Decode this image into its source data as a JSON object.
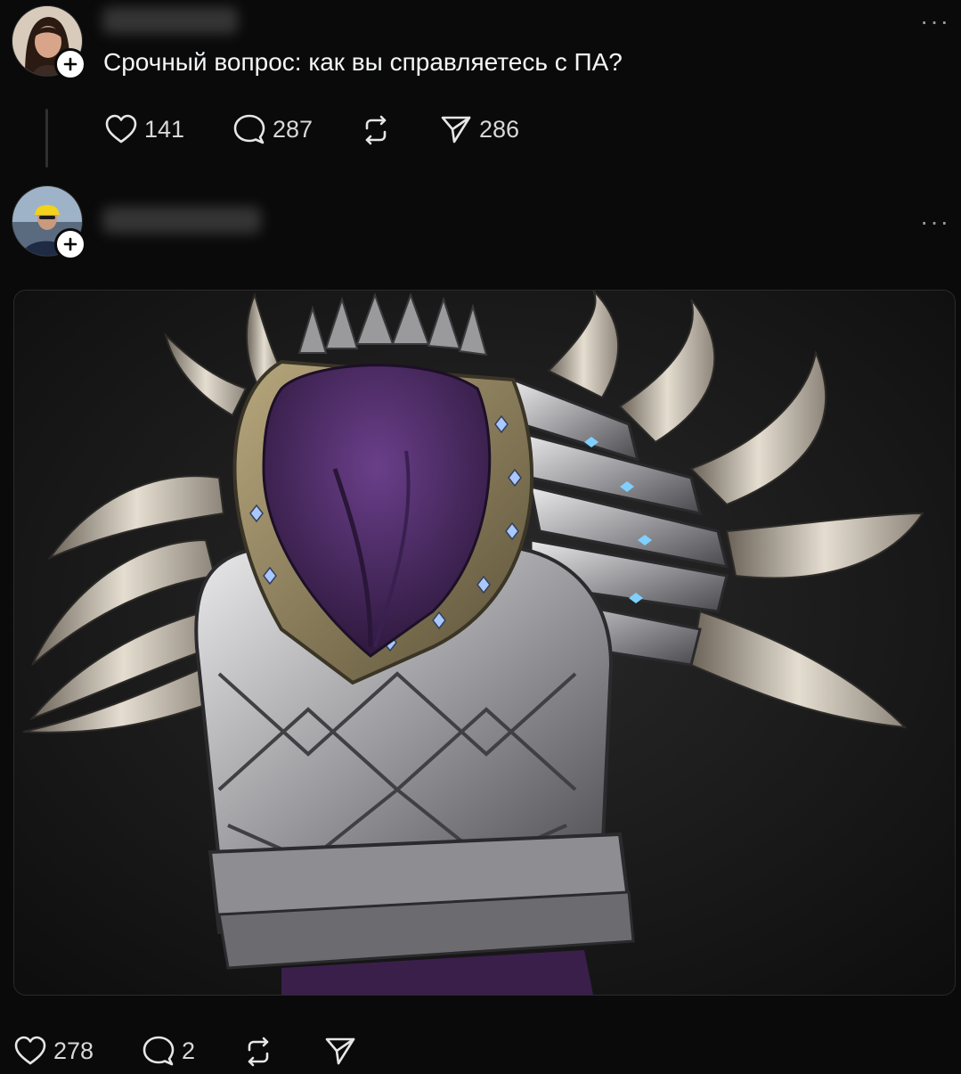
{
  "post1": {
    "avatar_icon": "user-avatar-woman",
    "text": "Срочный вопрос: как вы справляетесь с ПА?",
    "more": "···",
    "stats": {
      "likes": "141",
      "comments": "287",
      "repost_icon": "repost-icon",
      "shares": "286"
    }
  },
  "post2": {
    "avatar_icon": "user-avatar-man",
    "more": "···",
    "media_icon": "armor-artwork-image",
    "stats": {
      "likes": "278",
      "comments": "2",
      "repost_icon": "repost-icon",
      "share_icon": "share-icon"
    }
  },
  "colors": {
    "background": "#0a0a0a",
    "text": "#f3f5f7",
    "muted": "#9a9a9a",
    "purple": "#4a2a5e"
  }
}
